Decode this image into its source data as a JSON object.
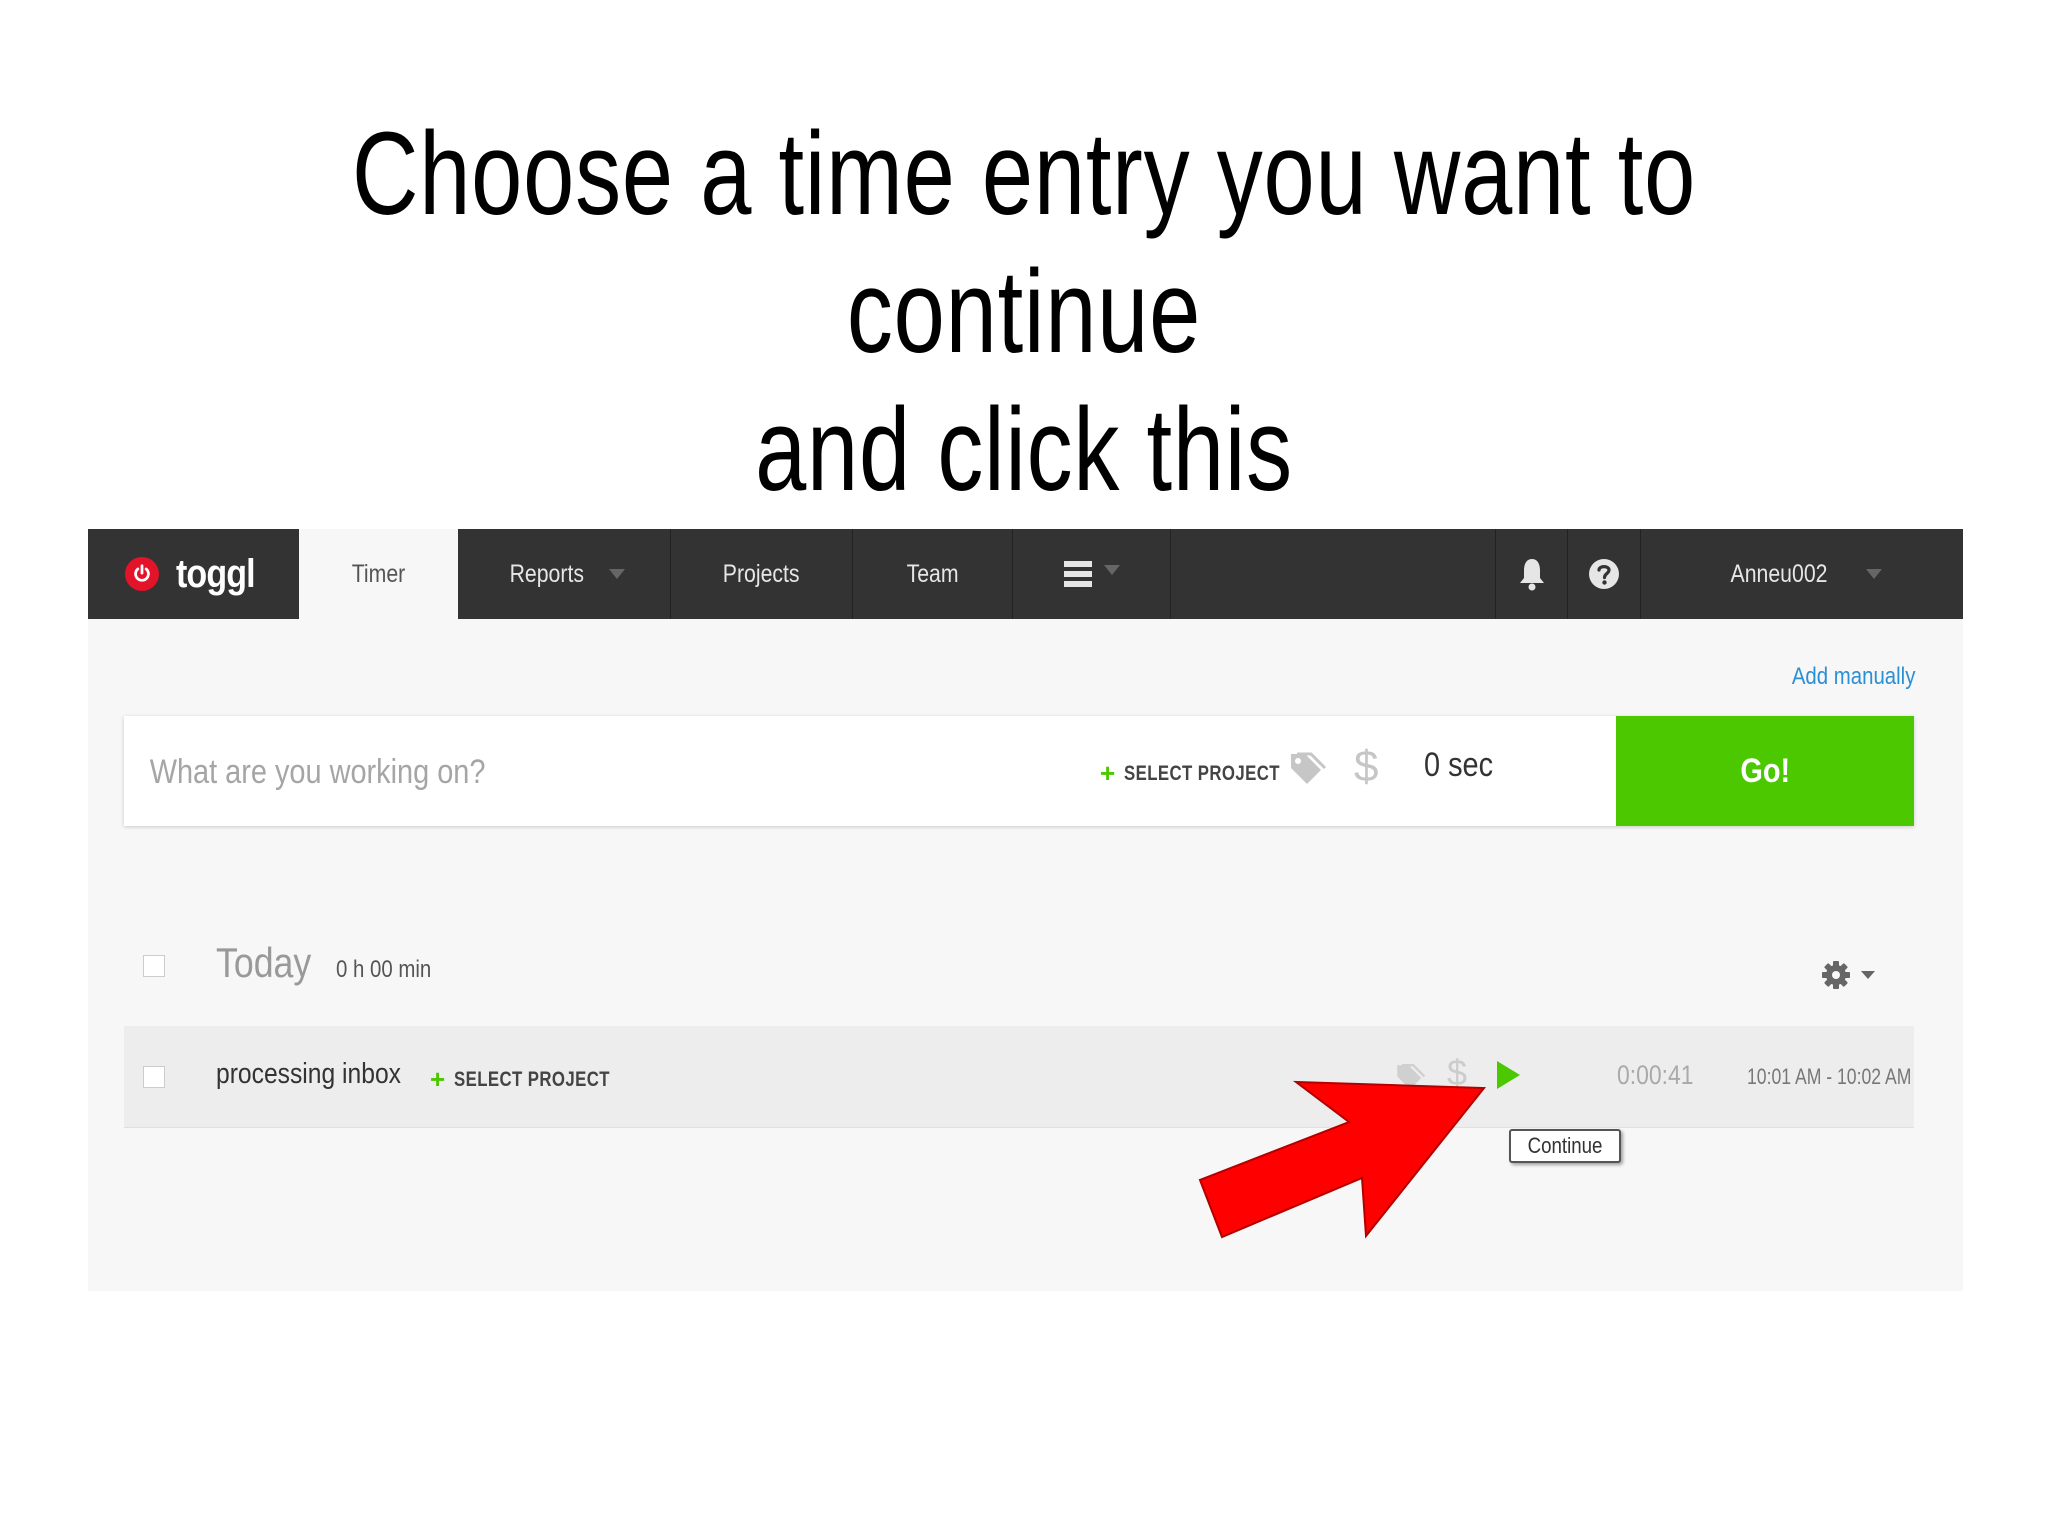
{
  "slide": {
    "headline_line1": "Choose a time entry you want to continue",
    "headline_line2": "and click this"
  },
  "nav": {
    "logo_text": "toggl",
    "tabs": {
      "timer": "Timer",
      "reports": "Reports",
      "projects": "Projects",
      "team": "Team"
    },
    "user": "Anneu002"
  },
  "timer_bar": {
    "add_manually": "Add manually",
    "placeholder": "What are you working on?",
    "select_project": "SELECT PROJECT",
    "duration": "0 sec",
    "go_label": "Go!"
  },
  "day": {
    "title": "Today",
    "total": "0 h 00 min"
  },
  "entries": [
    {
      "description": "processing inbox",
      "select_project": "SELECT PROJECT",
      "duration": "0:00:41",
      "time_range": "10:01 AM - 10:02 AM"
    }
  ],
  "tooltip": "Continue",
  "colors": {
    "nav_bg": "#333333",
    "accent_green": "#4bc800",
    "link_blue": "#2b8fd6",
    "logo_red": "#e3132a",
    "arrow_red": "#ff0000"
  }
}
